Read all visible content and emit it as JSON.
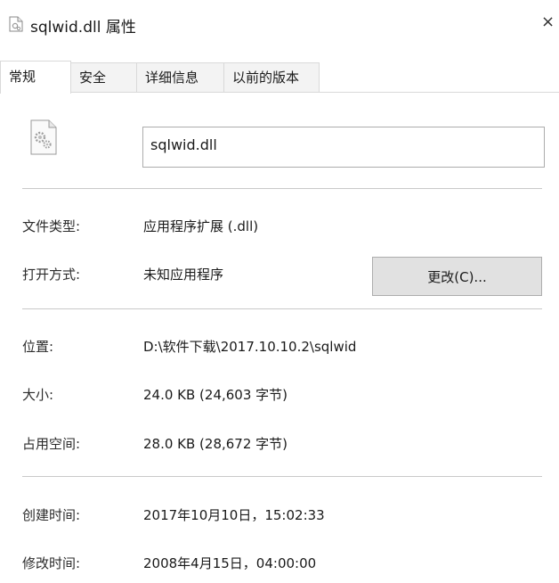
{
  "window": {
    "title": "sqlwid.dll 属性",
    "close_label": "×"
  },
  "tabs": [
    {
      "label": "常规",
      "active": true
    },
    {
      "label": "安全",
      "active": false
    },
    {
      "label": "详细信息",
      "active": false
    },
    {
      "label": "以前的版本",
      "active": false
    }
  ],
  "general": {
    "file_name": "sqlwid.dll",
    "file_type_label": "文件类型:",
    "file_type_value": "应用程序扩展 (.dll)",
    "opens_with_label": "打开方式:",
    "opens_with_value": "未知应用程序",
    "change_button": "更改(C)...",
    "location_label": "位置:",
    "location_value": "D:\\软件下载\\2017.10.10.2\\sqlwid",
    "size_label": "大小:",
    "size_value": "24.0 KB (24,603 字节)",
    "size_on_disk_label": "占用空间:",
    "size_on_disk_value": "28.0 KB (28,672 字节)",
    "created_label": "创建时间:",
    "created_value": "2017年10月10日，15:02:33",
    "modified_label": "修改时间:",
    "modified_value": "2008年4月15日，04:00:00"
  },
  "colors": {
    "tab_inactive_bg": "#f3f3f3",
    "button_bg": "#e1e1e1",
    "separator": "#c9c9c9"
  },
  "icons": {
    "title_icon": "dll-file-icon",
    "file_icon": "dll-file-gears-icon"
  }
}
